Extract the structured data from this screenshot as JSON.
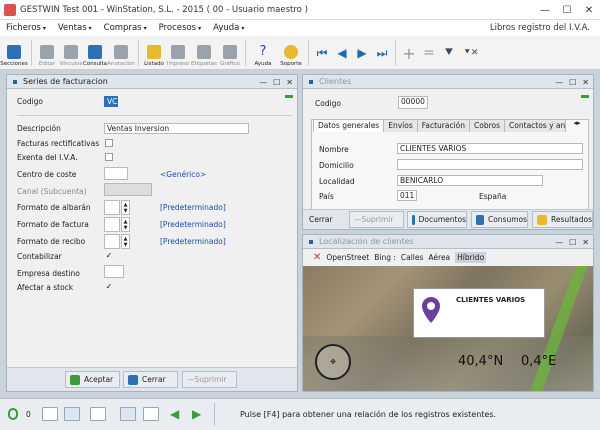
{
  "window": {
    "title": "GESTWIN  Test  001 - WinStation, S.L. - 2015 ( 00 - Usuario maestro )",
    "min": "—",
    "max": "☐",
    "close": "✕"
  },
  "menu": {
    "items": [
      "Ficheros",
      "Ventas",
      "Compras",
      "Procesos",
      "Ayuda"
    ],
    "right_label": "Libros registro del I.V.A."
  },
  "toolbar": {
    "buttons": [
      {
        "label": "Secciones"
      },
      {
        "label": "Editar"
      },
      {
        "label": "Vínculos"
      },
      {
        "label": "Consulta"
      },
      {
        "label": "Anotación"
      },
      {
        "label": "Listado"
      },
      {
        "label": "Impreso"
      },
      {
        "label": "Etiquetas"
      },
      {
        "label": "Gráfico"
      },
      {
        "label": "Ayuda"
      },
      {
        "label": "Soporte"
      }
    ],
    "nav": [
      "⏮",
      "◀",
      "▶",
      "⏭"
    ],
    "plus": "+",
    "equals": "=",
    "filter": "⯆",
    "filter_clear": "⯆✕"
  },
  "series_panel": {
    "title": "Series de facturacion",
    "codigo_label": "Codigo",
    "codigo_value": "VC",
    "descripcion_label": "Descripción",
    "descripcion_value": "Ventas Inversion",
    "facturas_rect_label": "Facturas rectificativas",
    "exenta_label": "Exenta del I.V.A.",
    "centro_label": "Centro de coste",
    "centro_link": "<Genérico>",
    "canal_label": "Canal (Subcuenta)",
    "formato_albaran_label": "Formato de albarán",
    "formato_albaran_link": "[Predeterminado]",
    "formato_factura_label": "Formato de factura",
    "formato_factura_link": "[Predeterminado]",
    "formato_recibo_label": "Formato de recibo",
    "formato_recibo_link": "[Predeterminado]",
    "contabilizar_label": "Contabilizar",
    "contabilizar_check": "✓",
    "empresa_label": "Empresa destino",
    "afectar_label": "Afectar a stock",
    "afectar_check": "✓",
    "btn_aceptar": "Aceptar",
    "btn_cerrar": "Cerrar",
    "btn_suprimir": "Suprimir"
  },
  "clientes_panel": {
    "title": "Clientes",
    "codigo_label": "Codigo",
    "codigo_value": "00000",
    "tabs": [
      "Datos generales",
      "Envíos",
      "Facturación",
      "Cobros",
      "Contactos y anotacion"
    ],
    "nombre_label": "Nombre",
    "nombre_value": "CLIENTES VARIOS",
    "domicilio_label": "Domicilio",
    "domicilio_value": "",
    "localidad_label": "Localidad",
    "localidad_value": "BENICARLO",
    "pais_label": "País",
    "pais_code": "011",
    "pais_name": "España",
    "btn_cerrar": "Cerrar",
    "btn_suprimir": "Suprimir",
    "btn_documentos": "Documentos",
    "btn_consumos": "Consumos",
    "btn_resultados": "Resultados"
  },
  "map_panel": {
    "title": "Localización de clientes",
    "close_x": "✕",
    "providers": [
      "OpenStreet",
      "Bing :",
      "Calles",
      "Aérea",
      "Híbrido"
    ],
    "marker_label": "CLIENTES VARIOS",
    "lat": "40,4°N",
    "lon": "0,4°E"
  },
  "status": {
    "count": "0",
    "message": "Pulse [F4] para obtener una relación de los registros existentes."
  },
  "colors": {
    "accent": "#2f6fb5",
    "green": "#3c9a3c"
  }
}
